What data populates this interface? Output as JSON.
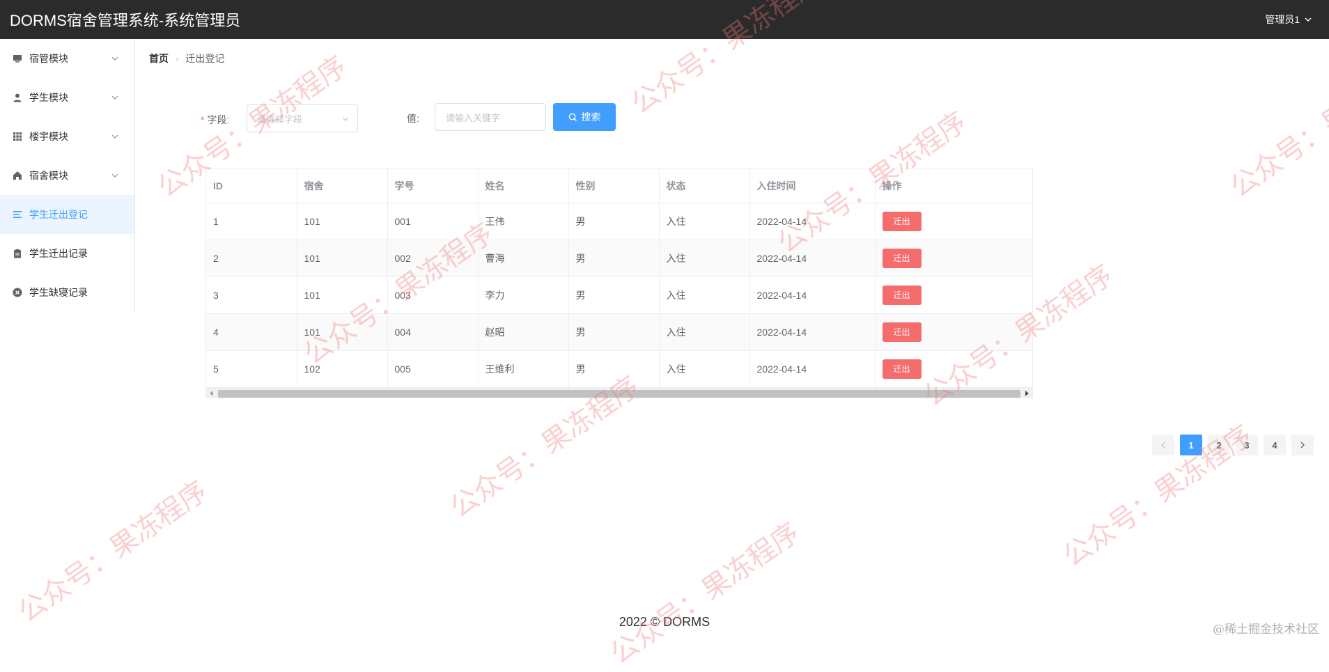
{
  "header": {
    "title": "DORMS宿舍管理系统-系统管理员",
    "user": "管理员1"
  },
  "sidebar": {
    "items": [
      {
        "label": "宿管模块",
        "icon": "monitor-icon",
        "expandable": true,
        "active": false
      },
      {
        "label": "学生模块",
        "icon": "user-icon",
        "expandable": true,
        "active": false
      },
      {
        "label": "楼宇模块",
        "icon": "grid-icon",
        "expandable": true,
        "active": false
      },
      {
        "label": "宿舍模块",
        "icon": "home-icon",
        "expandable": true,
        "active": false
      },
      {
        "label": "学生迁出登记",
        "icon": "list-icon",
        "expandable": false,
        "active": true
      },
      {
        "label": "学生迁出记录",
        "icon": "clipboard-icon",
        "expandable": false,
        "active": false
      },
      {
        "label": "学生缺寝记录",
        "icon": "circle-close-icon",
        "expandable": false,
        "active": false
      }
    ]
  },
  "breadcrumb": {
    "home": "首页",
    "separator": "›",
    "current": "迁出登记"
  },
  "search": {
    "field_label": "字段:",
    "field_required_mark": "*",
    "field_placeholder": "请选择字段",
    "value_label": "值:",
    "value_placeholder": "请输入关键字",
    "button_label": "搜索"
  },
  "table": {
    "columns": [
      "ID",
      "宿舍",
      "学号",
      "姓名",
      "性别",
      "状态",
      "入住时间",
      "操作"
    ],
    "rows": [
      {
        "id": "1",
        "dorm": "101",
        "student_no": "001",
        "name": "王伟",
        "gender": "男",
        "status": "入住",
        "checkin": "2022-04-14",
        "action": "迁出"
      },
      {
        "id": "2",
        "dorm": "101",
        "student_no": "002",
        "name": "曹海",
        "gender": "男",
        "status": "入住",
        "checkin": "2022-04-14",
        "action": "迁出"
      },
      {
        "id": "3",
        "dorm": "101",
        "student_no": "003",
        "name": "李力",
        "gender": "男",
        "status": "入住",
        "checkin": "2022-04-14",
        "action": "迁出"
      },
      {
        "id": "4",
        "dorm": "101",
        "student_no": "004",
        "name": "赵昭",
        "gender": "男",
        "status": "入住",
        "checkin": "2022-04-14",
        "action": "迁出"
      },
      {
        "id": "5",
        "dorm": "102",
        "student_no": "005",
        "name": "王维利",
        "gender": "男",
        "status": "入住",
        "checkin": "2022-04-14",
        "action": "迁出"
      }
    ]
  },
  "pagination": {
    "pages": [
      "1",
      "2",
      "3",
      "4"
    ],
    "current": "1"
  },
  "footer": {
    "text": "2022 © DORMS"
  },
  "credit": "@稀土掘金技术社区",
  "watermark": "公众号：果冻程序",
  "colors": {
    "primary": "#409eff",
    "danger": "#f56c6c",
    "topbar": "#2b2b2b"
  }
}
